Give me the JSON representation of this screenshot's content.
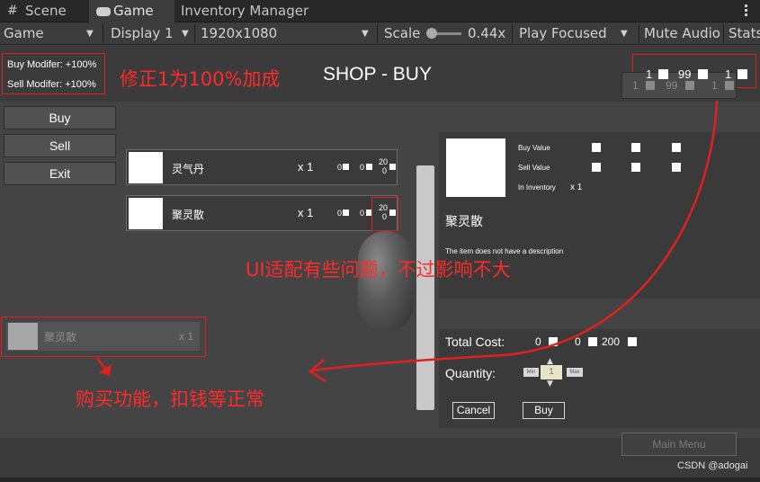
{
  "editor": {
    "tabs": [
      {
        "icon": "grid-icon",
        "label": "Scene"
      },
      {
        "icon": "gamepad-icon",
        "label": "Game"
      },
      {
        "label": "Inventory Manager"
      }
    ],
    "toolbar": {
      "game_view": "Game",
      "display": "Display 1",
      "resolution": "1920x1080",
      "scale_label": "Scale",
      "scale_value": "0.44x",
      "play_mode": "Play Focused",
      "mute_audio": "Mute Audio",
      "stats": "Stats"
    }
  },
  "hud": {
    "buy_modifier": "Buy Modifer: +100%",
    "sell_modifier": "Sell Modifer: +100%",
    "title": "SHOP - BUY",
    "currency": {
      "a": "1",
      "b": "99",
      "c": "1"
    },
    "currency_shadow": {
      "a": "1",
      "b": "99",
      "c": "1"
    }
  },
  "menu": {
    "buy": "Buy",
    "sell": "Sell",
    "exit": "Exit"
  },
  "shop_items": [
    {
      "name": "灵气丹",
      "qty": "x 1",
      "c1": "0",
      "c2": "0",
      "c3_top": "20",
      "c3_bottom": "0"
    },
    {
      "name": "聚灵散",
      "qty": "x 1",
      "c1": "0",
      "c2": "0",
      "c3_top": "20",
      "c3_bottom": "0"
    }
  ],
  "detail": {
    "buy_value_label": "Buy Value",
    "sell_value_label": "Sell Value",
    "in_inventory_label": "In Inventory",
    "in_inventory_value": "x 1",
    "item_name": "聚灵散",
    "description": "The item does not have a description"
  },
  "purchase": {
    "total_cost_label": "Total Cost:",
    "cost_a": "0",
    "cost_b": "0",
    "cost_c": "200",
    "quantity_label": "Quantity:",
    "min_label": "Min",
    "max_label": "Max",
    "quantity_value": "1",
    "cancel": "Cancel",
    "buy": "Buy"
  },
  "inventory_slot": {
    "name": "聚灵散",
    "qty": "x 1"
  },
  "main_menu": "Main Menu",
  "annotations": {
    "note_modifier": "修正1为100%加成",
    "note_ui": "UI适配有些问题，不过影响不大",
    "note_buy": "购买功能，扣钱等正常"
  },
  "watermark": "CSDN @adogai",
  "colors": {
    "annotation": "#e02020",
    "editor_bg": "#3c3c3c",
    "game_bg": "#444444"
  }
}
